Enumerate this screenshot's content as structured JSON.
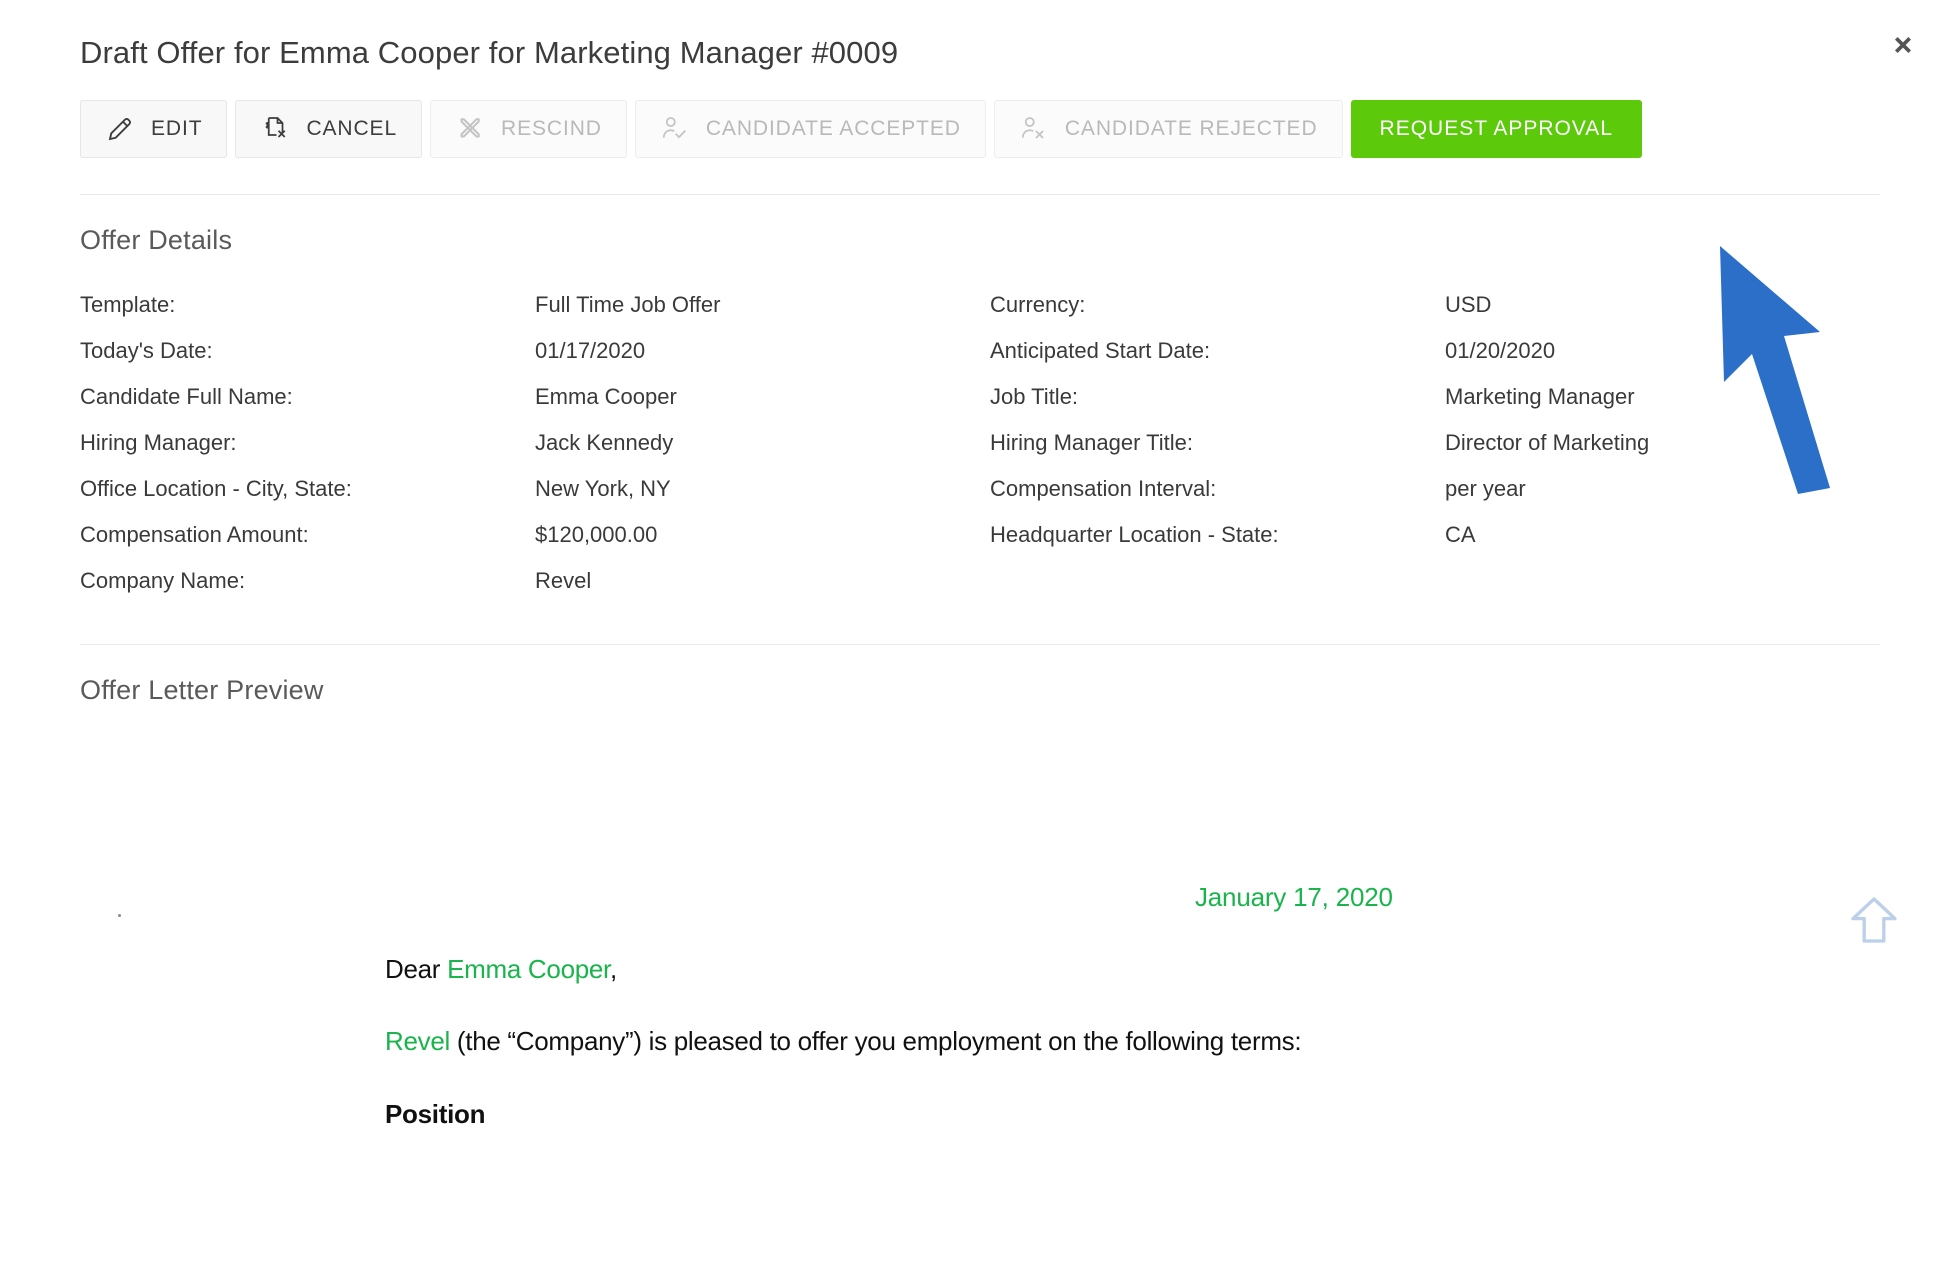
{
  "header": {
    "title": "Draft Offer for Emma Cooper for Marketing Manager #0009",
    "close_icon": "close-icon",
    "close_glyph": "✖"
  },
  "toolbar": {
    "buttons": [
      {
        "label": "EDIT",
        "icon": "pencil-icon",
        "state": "enabled",
        "style": "default"
      },
      {
        "label": "CANCEL",
        "icon": "document-dollar-x-icon",
        "state": "enabled",
        "style": "default"
      },
      {
        "label": "RESCIND",
        "icon": "x-cross-icon",
        "state": "disabled",
        "style": "default"
      },
      {
        "label": "CANDIDATE ACCEPTED",
        "icon": "person-check-icon",
        "state": "disabled",
        "style": "default"
      },
      {
        "label": "CANDIDATE REJECTED",
        "icon": "person-x-icon",
        "state": "disabled",
        "style": "default"
      },
      {
        "label": "REQUEST APPROVAL",
        "icon": "none",
        "state": "enabled",
        "style": "primary"
      }
    ]
  },
  "offer_details": {
    "section_title": "Offer Details",
    "rows": [
      {
        "label_left": "Template:",
        "value_left": "Full Time Job Offer",
        "label_right": "Currency:",
        "value_right": "USD"
      },
      {
        "label_left": "Today's Date:",
        "value_left": "01/17/2020",
        "label_right": "Anticipated Start Date:",
        "value_right": "01/20/2020"
      },
      {
        "label_left": "Candidate Full Name:",
        "value_left": "Emma Cooper",
        "label_right": "Job Title:",
        "value_right": "Marketing Manager"
      },
      {
        "label_left": "Hiring Manager:",
        "value_left": "Jack Kennedy",
        "label_right": "Hiring Manager Title:",
        "value_right": "Director of Marketing"
      },
      {
        "label_left": "Office Location - City, State:",
        "value_left": "New York, NY",
        "label_right": "Compensation Interval:",
        "value_right": "per year"
      },
      {
        "label_left": "Compensation Amount:",
        "value_left": "$120,000.00",
        "label_right": "Headquarter Location - State:",
        "value_right": "CA"
      },
      {
        "label_left": "Company Name:",
        "value_left": "Revel",
        "label_right": "",
        "value_right": ""
      }
    ]
  },
  "preview": {
    "section_title": "Offer Letter Preview",
    "scroll_up_icon": "scroll-up-arrow-icon",
    "letter": {
      "date": "January 17, 2020",
      "salutation_prefix": "Dear ",
      "salutation_name": "Emma Cooper",
      "salutation_suffix": ",",
      "body_company": "Revel",
      "body_rest": " (the “Company”) is pleased to offer you employment on the following terms:",
      "heading_position": "Position"
    }
  },
  "cursor": {
    "name": "mouse-pointer-arrow",
    "color": "#2b6fc8"
  },
  "colors": {
    "primary_green": "#5cc90b",
    "letter_green": "#19b44b",
    "text": "#3a3a3a",
    "disabled_text": "#b9b9b9",
    "rule": "#ebebeb",
    "scroll_arrow": "#bdd0ea",
    "cursor_blue": "#2b6fc8"
  }
}
